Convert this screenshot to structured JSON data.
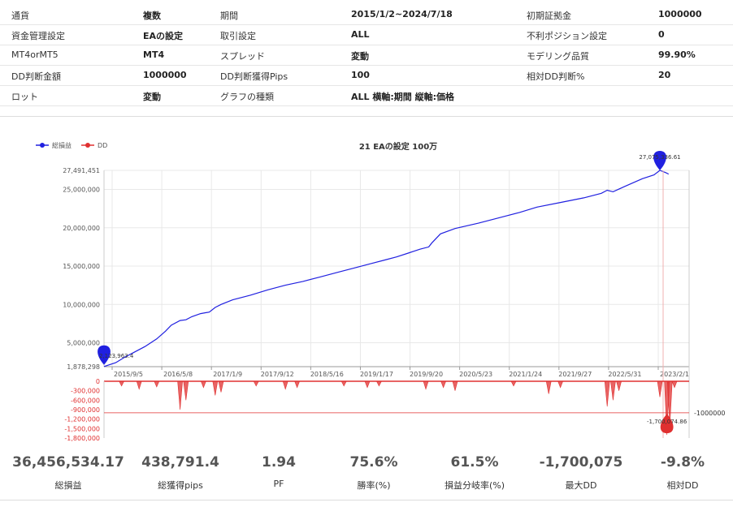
{
  "settings": [
    [
      {
        "label": "通貨",
        "value": "複数"
      },
      {
        "label": "期間",
        "value": "2015/1/2~2024/7/18"
      },
      {
        "label": "初期証拠金",
        "value": "1000000"
      }
    ],
    [
      {
        "label": "資金管理設定",
        "value": "EAの設定"
      },
      {
        "label": "取引設定",
        "value": "ALL"
      },
      {
        "label": "不利ポジション設定",
        "value": "0"
      }
    ],
    [
      {
        "label": "MT4orMT5",
        "value": "MT4"
      },
      {
        "label": "スプレッド",
        "value": "変動"
      },
      {
        "label": "モデリング品質",
        "value": "99.90%"
      }
    ],
    [
      {
        "label": "DD判断金額",
        "value": "1000000"
      },
      {
        "label": "DD判断獲得Pips",
        "value": "100"
      },
      {
        "label": "相対DD判断%",
        "value": "20"
      }
    ],
    [
      {
        "label": "ロット",
        "value": "変動"
      },
      {
        "label": "グラフの種類",
        "value": "ALL 横軸:期間 縦軸:価格"
      },
      {
        "label": "",
        "value": ""
      }
    ]
  ],
  "chart_data": {
    "type": "line",
    "title": "21 EAの設定 100万",
    "legend": [
      {
        "name": "総損益",
        "color": "#2020e0"
      },
      {
        "name": "DD",
        "color": "#e03030"
      }
    ],
    "x_ticks": [
      "2015/9/5",
      "2016/5/8",
      "2017/1/9",
      "2017/9/12",
      "2018/5/16",
      "2019/1/17",
      "2019/9/20",
      "2020/5/23",
      "2021/1/24",
      "2021/9/27",
      "2022/5/31",
      "2023/2/1"
    ],
    "equity": {
      "ylim": [
        1878298,
        27491451
      ],
      "y_ticks": [
        {
          "v": 27491451,
          "t": "27,491,451"
        },
        {
          "v": 25000000,
          "t": "25,000,000"
        },
        {
          "v": 20000000,
          "t": "20,000,000"
        },
        {
          "v": 15000000,
          "t": "15,000,000"
        },
        {
          "v": 10000000,
          "t": "10,000,000"
        },
        {
          "v": 5000000,
          "t": "5,000,000"
        },
        {
          "v": 1878298,
          "t": "1,878,298"
        }
      ],
      "points": [
        [
          0,
          1900000
        ],
        [
          0.02,
          2400000
        ],
        [
          0.035,
          3100000
        ],
        [
          0.05,
          3700000
        ],
        [
          0.07,
          4500000
        ],
        [
          0.09,
          5500000
        ],
        [
          0.105,
          6500000
        ],
        [
          0.115,
          7300000
        ],
        [
          0.13,
          7900000
        ],
        [
          0.14,
          8000000
        ],
        [
          0.15,
          8400000
        ],
        [
          0.165,
          8800000
        ],
        [
          0.18,
          9000000
        ],
        [
          0.19,
          9600000
        ],
        [
          0.2,
          10000000
        ],
        [
          0.22,
          10600000
        ],
        [
          0.25,
          11200000
        ],
        [
          0.28,
          11900000
        ],
        [
          0.31,
          12500000
        ],
        [
          0.34,
          13000000
        ],
        [
          0.37,
          13600000
        ],
        [
          0.4,
          14200000
        ],
        [
          0.43,
          14800000
        ],
        [
          0.455,
          15300000
        ],
        [
          0.48,
          15800000
        ],
        [
          0.5,
          16200000
        ],
        [
          0.52,
          16700000
        ],
        [
          0.54,
          17200000
        ],
        [
          0.555,
          17500000
        ],
        [
          0.56,
          18000000
        ],
        [
          0.575,
          19200000
        ],
        [
          0.6,
          19900000
        ],
        [
          0.64,
          20600000
        ],
        [
          0.68,
          21400000
        ],
        [
          0.71,
          22000000
        ],
        [
          0.74,
          22700000
        ],
        [
          0.78,
          23300000
        ],
        [
          0.82,
          23900000
        ],
        [
          0.85,
          24500000
        ],
        [
          0.86,
          24900000
        ],
        [
          0.87,
          24700000
        ],
        [
          0.89,
          25400000
        ],
        [
          0.92,
          26400000
        ],
        [
          0.94,
          26900000
        ],
        [
          0.95,
          27491451
        ],
        [
          0.96,
          27200000
        ],
        [
          0.965,
          27000000
        ]
      ],
      "start_label": "2,123,963.4",
      "end_label": "27,075,336.61"
    },
    "drawdown": {
      "ylim": [
        -1800000,
        0
      ],
      "y_ticks": [
        {
          "v": 0,
          "t": "0"
        },
        {
          "v": -300000,
          "t": "-300,000"
        },
        {
          "v": -600000,
          "t": "-600,000"
        },
        {
          "v": -900000,
          "t": "-900,000"
        },
        {
          "v": -1200000,
          "t": "-1,200,000"
        },
        {
          "v": -1500000,
          "t": "-1,500,000"
        },
        {
          "v": -1800000,
          "t": "-1,800,000"
        }
      ],
      "threshold": -1000000,
      "threshold_label": "-1000000",
      "spikes": [
        [
          0.03,
          -150000
        ],
        [
          0.06,
          -250000
        ],
        [
          0.09,
          -180000
        ],
        [
          0.13,
          -900000
        ],
        [
          0.14,
          -600000
        ],
        [
          0.17,
          -200000
        ],
        [
          0.19,
          -450000
        ],
        [
          0.2,
          -350000
        ],
        [
          0.26,
          -150000
        ],
        [
          0.31,
          -250000
        ],
        [
          0.33,
          -200000
        ],
        [
          0.41,
          -150000
        ],
        [
          0.45,
          -200000
        ],
        [
          0.47,
          -150000
        ],
        [
          0.55,
          -250000
        ],
        [
          0.58,
          -200000
        ],
        [
          0.6,
          -300000
        ],
        [
          0.7,
          -150000
        ],
        [
          0.76,
          -400000
        ],
        [
          0.78,
          -200000
        ],
        [
          0.86,
          -800000
        ],
        [
          0.87,
          -600000
        ],
        [
          0.88,
          -300000
        ],
        [
          0.95,
          -500000
        ],
        [
          0.962,
          -1700075
        ],
        [
          0.967,
          -1400000
        ],
        [
          0.975,
          -200000
        ]
      ],
      "min_label": "-1,700,074.86"
    }
  },
  "stats": [
    {
      "value": "36,456,534.17",
      "label": "総損益"
    },
    {
      "value": "438,791.4",
      "label": "総獲得pips"
    },
    {
      "value": "1.94",
      "label": "PF"
    },
    {
      "value": "75.6%",
      "label": "勝率(%)"
    },
    {
      "value": "61.5%",
      "label": "損益分岐率(%)"
    },
    {
      "value": "-1,700,075",
      "label": "最大DD"
    },
    {
      "value": "-9.8%",
      "label": "相対DD"
    }
  ]
}
